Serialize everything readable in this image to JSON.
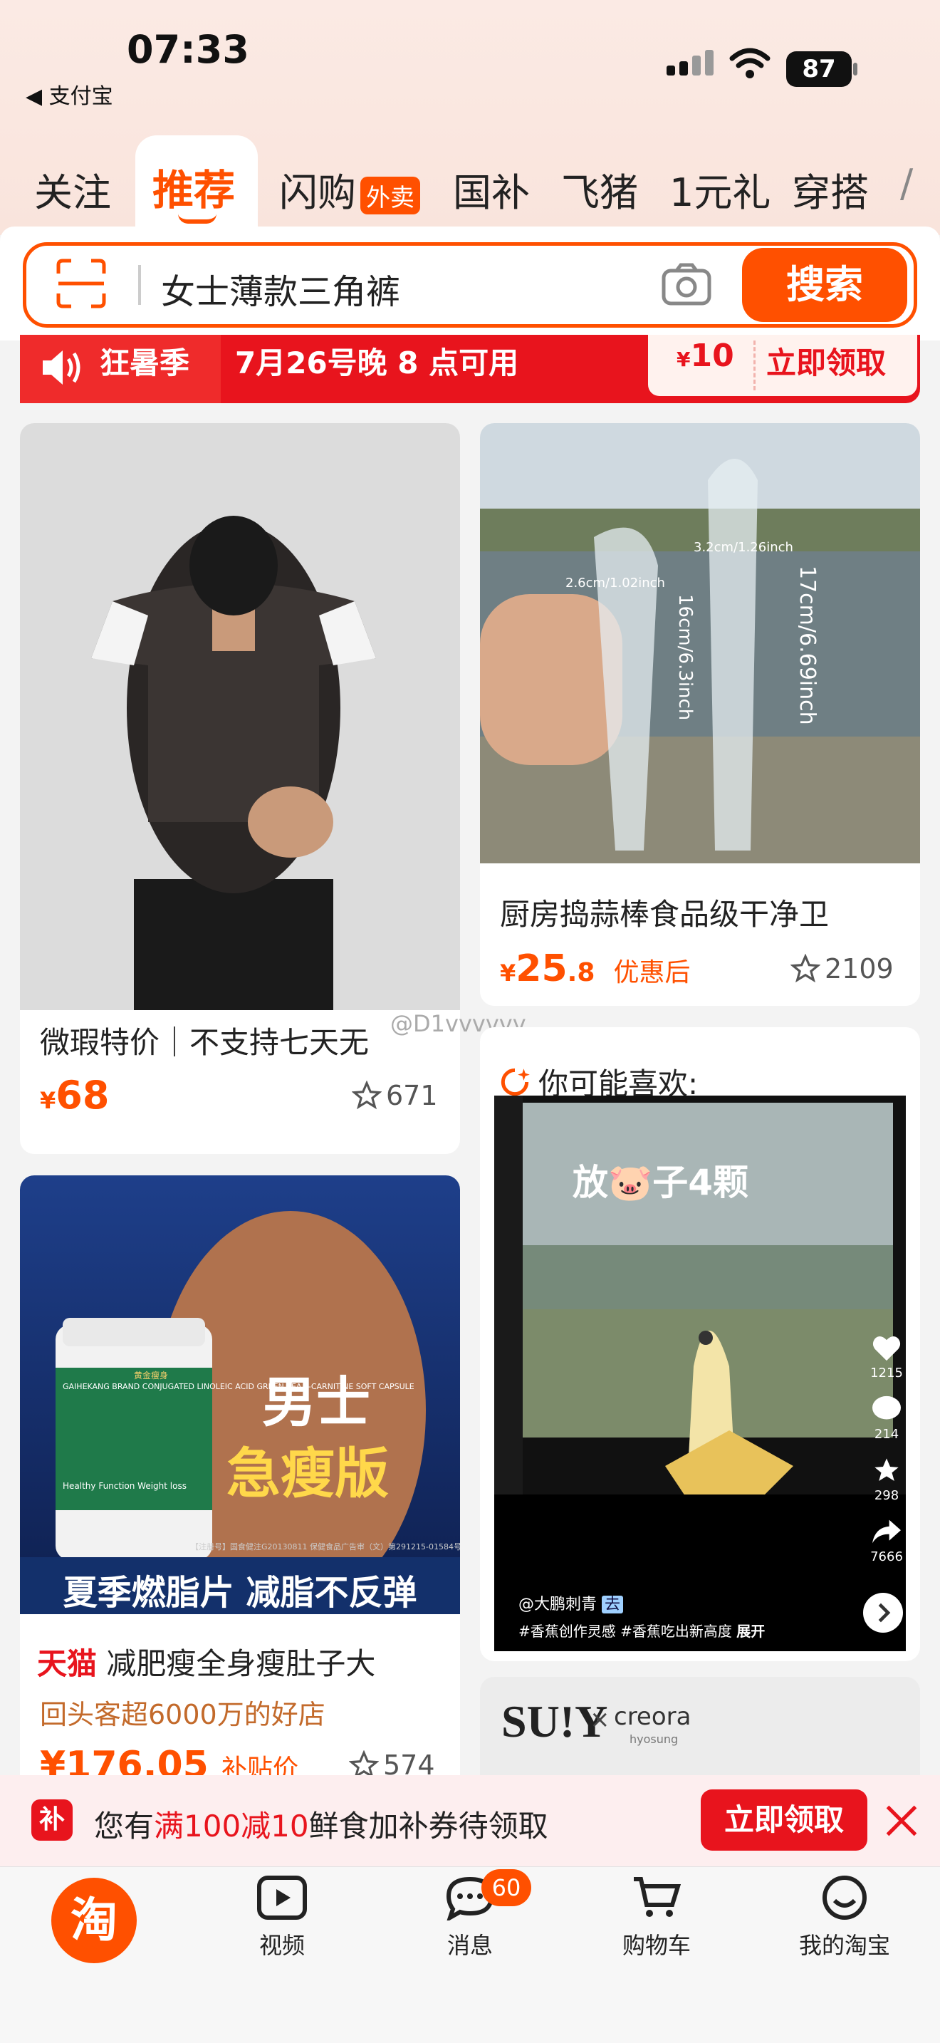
{
  "status_bar": {
    "time": "07:33",
    "back_app": "◀ 支付宝",
    "battery": "87"
  },
  "tabs": [
    {
      "label": "关注"
    },
    {
      "label": "推荐",
      "active": true
    },
    {
      "label": "闪购",
      "badge": "外卖"
    },
    {
      "label": "国补"
    },
    {
      "label": "飞猪"
    },
    {
      "label": "1元礼"
    },
    {
      "label": "穿搭"
    }
  ],
  "search": {
    "query": "女士薄款三角裤",
    "button": "搜索"
  },
  "promo": {
    "title": "狂暑季",
    "subtitle": "7月26号晚 8 点可用",
    "coupon_currency": "¥",
    "coupon_amount": "10",
    "cta": "立即领取"
  },
  "feed": {
    "card1": {
      "title": "微瑕特价｜不支持七天无",
      "currency": "¥",
      "price": "68",
      "favorites": "671"
    },
    "card2": {
      "title": "厨房捣蒜棒食品级干净卫",
      "currency": "¥",
      "price_int": "25",
      "price_dec": ".8",
      "price_note": "优惠后",
      "favorites": "2109",
      "image_labels": {
        "dim1": "2.6cm/1.02inch",
        "dim2": "3.2cm/1.26inch",
        "len1": "16cm/6.3inch",
        "len2": "17cm/6.69inch"
      }
    },
    "watermark": "@D1vvvvvv",
    "card3": {
      "image_text1": "男士",
      "image_text2": "急瘦版",
      "banner": "夏季燃脂片 减脂不反弹",
      "bottle_brand": "黄金瘦身",
      "bottle_label": "GAIHEKANG BRAND CONJUGATED LINOLEIC ACID GREEN TEA L-CARNITINE SOFT CAPSULE",
      "bottle_sub": "Healthy Function Weight loss",
      "fine_print": "【注册号】国食健注G20130811 保健食品广告审（文）第291215-01584号",
      "store_tag": "天猫",
      "title": "减肥瘦全身瘦肚子大",
      "subtitle": "回头客超6000万的好店",
      "price": "¥176.05",
      "price_note": "补贴价",
      "favorites": "574"
    },
    "card4": {
      "header": "你可能喜欢:",
      "video_caption": "放🐷子4颗",
      "likes": "1215",
      "comments": "214",
      "stars": "298",
      "shares": "7666",
      "author": "@大鹏刺青",
      "author_tag": "去",
      "tags": "#香蕉创作灵感 #香蕉吃出新高度",
      "expand": "展开"
    },
    "card5": {
      "brand": "SU!Y",
      "x": "×",
      "partner": "creora",
      "partner_sub": "hyosung"
    }
  },
  "bonus_bar": {
    "icon": "补",
    "prefix": "您有",
    "highlight": "满100减10",
    "suffix": "鲜食加补券待领取",
    "cta": "立即领取"
  },
  "bottom_nav": [
    {
      "label": "淘",
      "icon": "taobao-logo"
    },
    {
      "label": "视频",
      "icon": "play-icon"
    },
    {
      "label": "消息",
      "icon": "chat-icon",
      "badge": "60"
    },
    {
      "label": "购物车",
      "icon": "cart-icon"
    },
    {
      "label": "我的淘宝",
      "icon": "smile-icon"
    }
  ],
  "colors": {
    "accent": "#ff5000",
    "promo_red": "#e8141d",
    "bg": "#f3f3f3"
  }
}
